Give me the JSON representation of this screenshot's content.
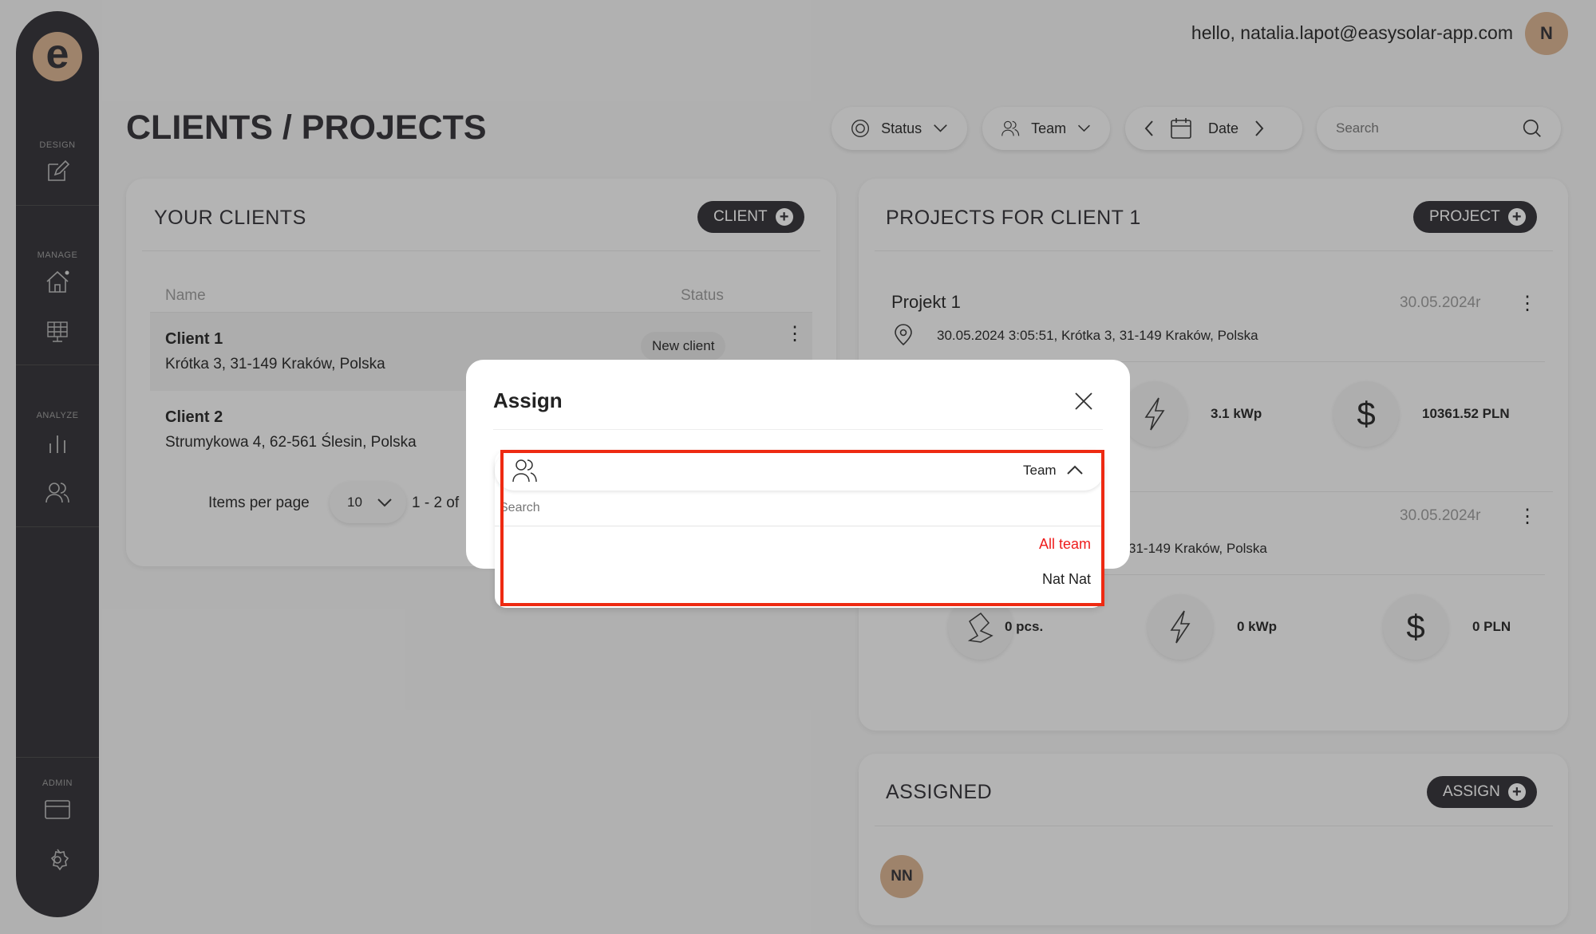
{
  "sidebar": {
    "logo": "e",
    "sections": [
      {
        "label": "DESIGN",
        "icons": [
          "edit-icon"
        ]
      },
      {
        "label": "MANAGE",
        "icons": [
          "home-icon",
          "solar-panel-icon"
        ]
      },
      {
        "label": "ANALYZE",
        "icons": [
          "bar-chart-icon",
          "users-icon"
        ]
      },
      {
        "label": "ADMIN",
        "icons": [
          "credit-card-icon",
          "gear-icon"
        ]
      }
    ]
  },
  "header": {
    "title": "CLIENTS / PROJECTS",
    "greeting": "hello, natalia.lapot@easysolar-app.com",
    "avatar": "N"
  },
  "filters": {
    "status": "Status",
    "team": "Team",
    "date": "Date",
    "search_placeholder": "Search"
  },
  "clients": {
    "title": "YOUR CLIENTS",
    "add_label": "CLIENT",
    "col_name": "Name",
    "col_status": "Status",
    "rows": [
      {
        "name": "Client 1",
        "address": "Krótka 3, 31-149 Kraków, Polska",
        "status": "New client"
      },
      {
        "name": "Client 2",
        "address": "Strumykowa 4, 62-561 Ślesin, Polska",
        "status": ""
      }
    ],
    "items_per_page_label": "Items per page",
    "items_per_page": "10",
    "range": "1 - 2 of"
  },
  "projects": {
    "title": "PROJECTS FOR CLIENT 1",
    "add_label": "PROJECT",
    "items": [
      {
        "name": "Projekt 1",
        "date": "30.05.2024r",
        "location": "30.05.2024 3:05:51, Krótka 3, 31-149 Kraków, Polska",
        "power": "3.1 kWp",
        "price": "10361.52 PLN"
      },
      {
        "date": "30.05.2024r",
        "location": "31-149 Kraków, Polska",
        "panels": "0 pcs.",
        "power": "0 kWp",
        "price": "0 PLN"
      }
    ]
  },
  "assigned": {
    "title": "ASSIGNED",
    "add_label": "ASSIGN",
    "members": [
      "NN"
    ]
  },
  "modal": {
    "title": "Assign",
    "select_label": "Team",
    "search_placeholder": "Search",
    "options": [
      {
        "label": "All team",
        "selected": true
      },
      {
        "label": "Nat Nat",
        "selected": false
      }
    ]
  },
  "colors": {
    "accent": "#d8b08c",
    "dark": "#2c2b30",
    "highlight": "#ee2a12",
    "selected_option": "#ee1c1c"
  }
}
